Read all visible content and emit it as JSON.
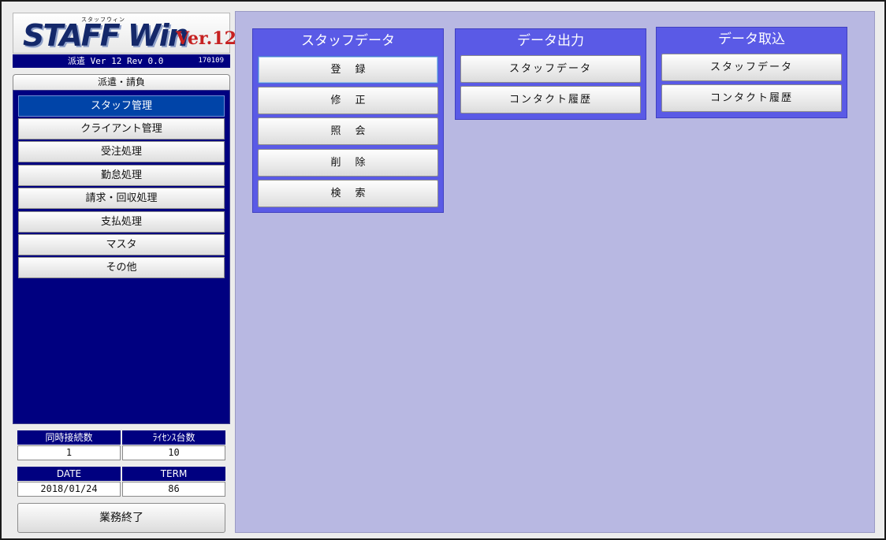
{
  "logo": {
    "small_text": "スタッフウィン",
    "main_text": "STAFF Win",
    "version_text": "Ver.12"
  },
  "version_bar": {
    "text": "派遣  Ver 12 Rev 0.0",
    "build": "170109"
  },
  "tab": {
    "label": "派遣・請負"
  },
  "nav": {
    "items": [
      {
        "label": "スタッフ管理",
        "active": true
      },
      {
        "label": "クライアント管理"
      },
      {
        "label": "受注処理"
      },
      {
        "label": "勤怠処理"
      },
      {
        "label": "請求・回収処理"
      },
      {
        "label": "支払処理"
      },
      {
        "label": "マスタ"
      },
      {
        "label": "その他"
      }
    ]
  },
  "connections": {
    "header_connections": "同時接続数",
    "header_license": "ﾗｲｾﾝｽ台数",
    "value_connections": "1",
    "value_license": "10"
  },
  "session": {
    "header_date": "DATE",
    "header_term": "TERM",
    "value_date": "2018/01/24",
    "value_term": "86"
  },
  "exit_button": {
    "label": "業務終了"
  },
  "groups": {
    "staff_data": {
      "title": "スタッフデータ",
      "buttons": [
        "登録",
        "修正",
        "照会",
        "削除",
        "検索"
      ]
    },
    "data_output": {
      "title": "データ出力",
      "buttons": [
        "スタッフデータ",
        "コンタクト履歴"
      ]
    },
    "data_import": {
      "title": "データ取込",
      "buttons": [
        "スタッフデータ",
        "コンタクト履歴"
      ]
    }
  },
  "colors": {
    "nav_bg": "#000080",
    "main_bg": "#b8b8e2",
    "group_bg": "#5a5ae6",
    "active_item": "#0044a8"
  }
}
